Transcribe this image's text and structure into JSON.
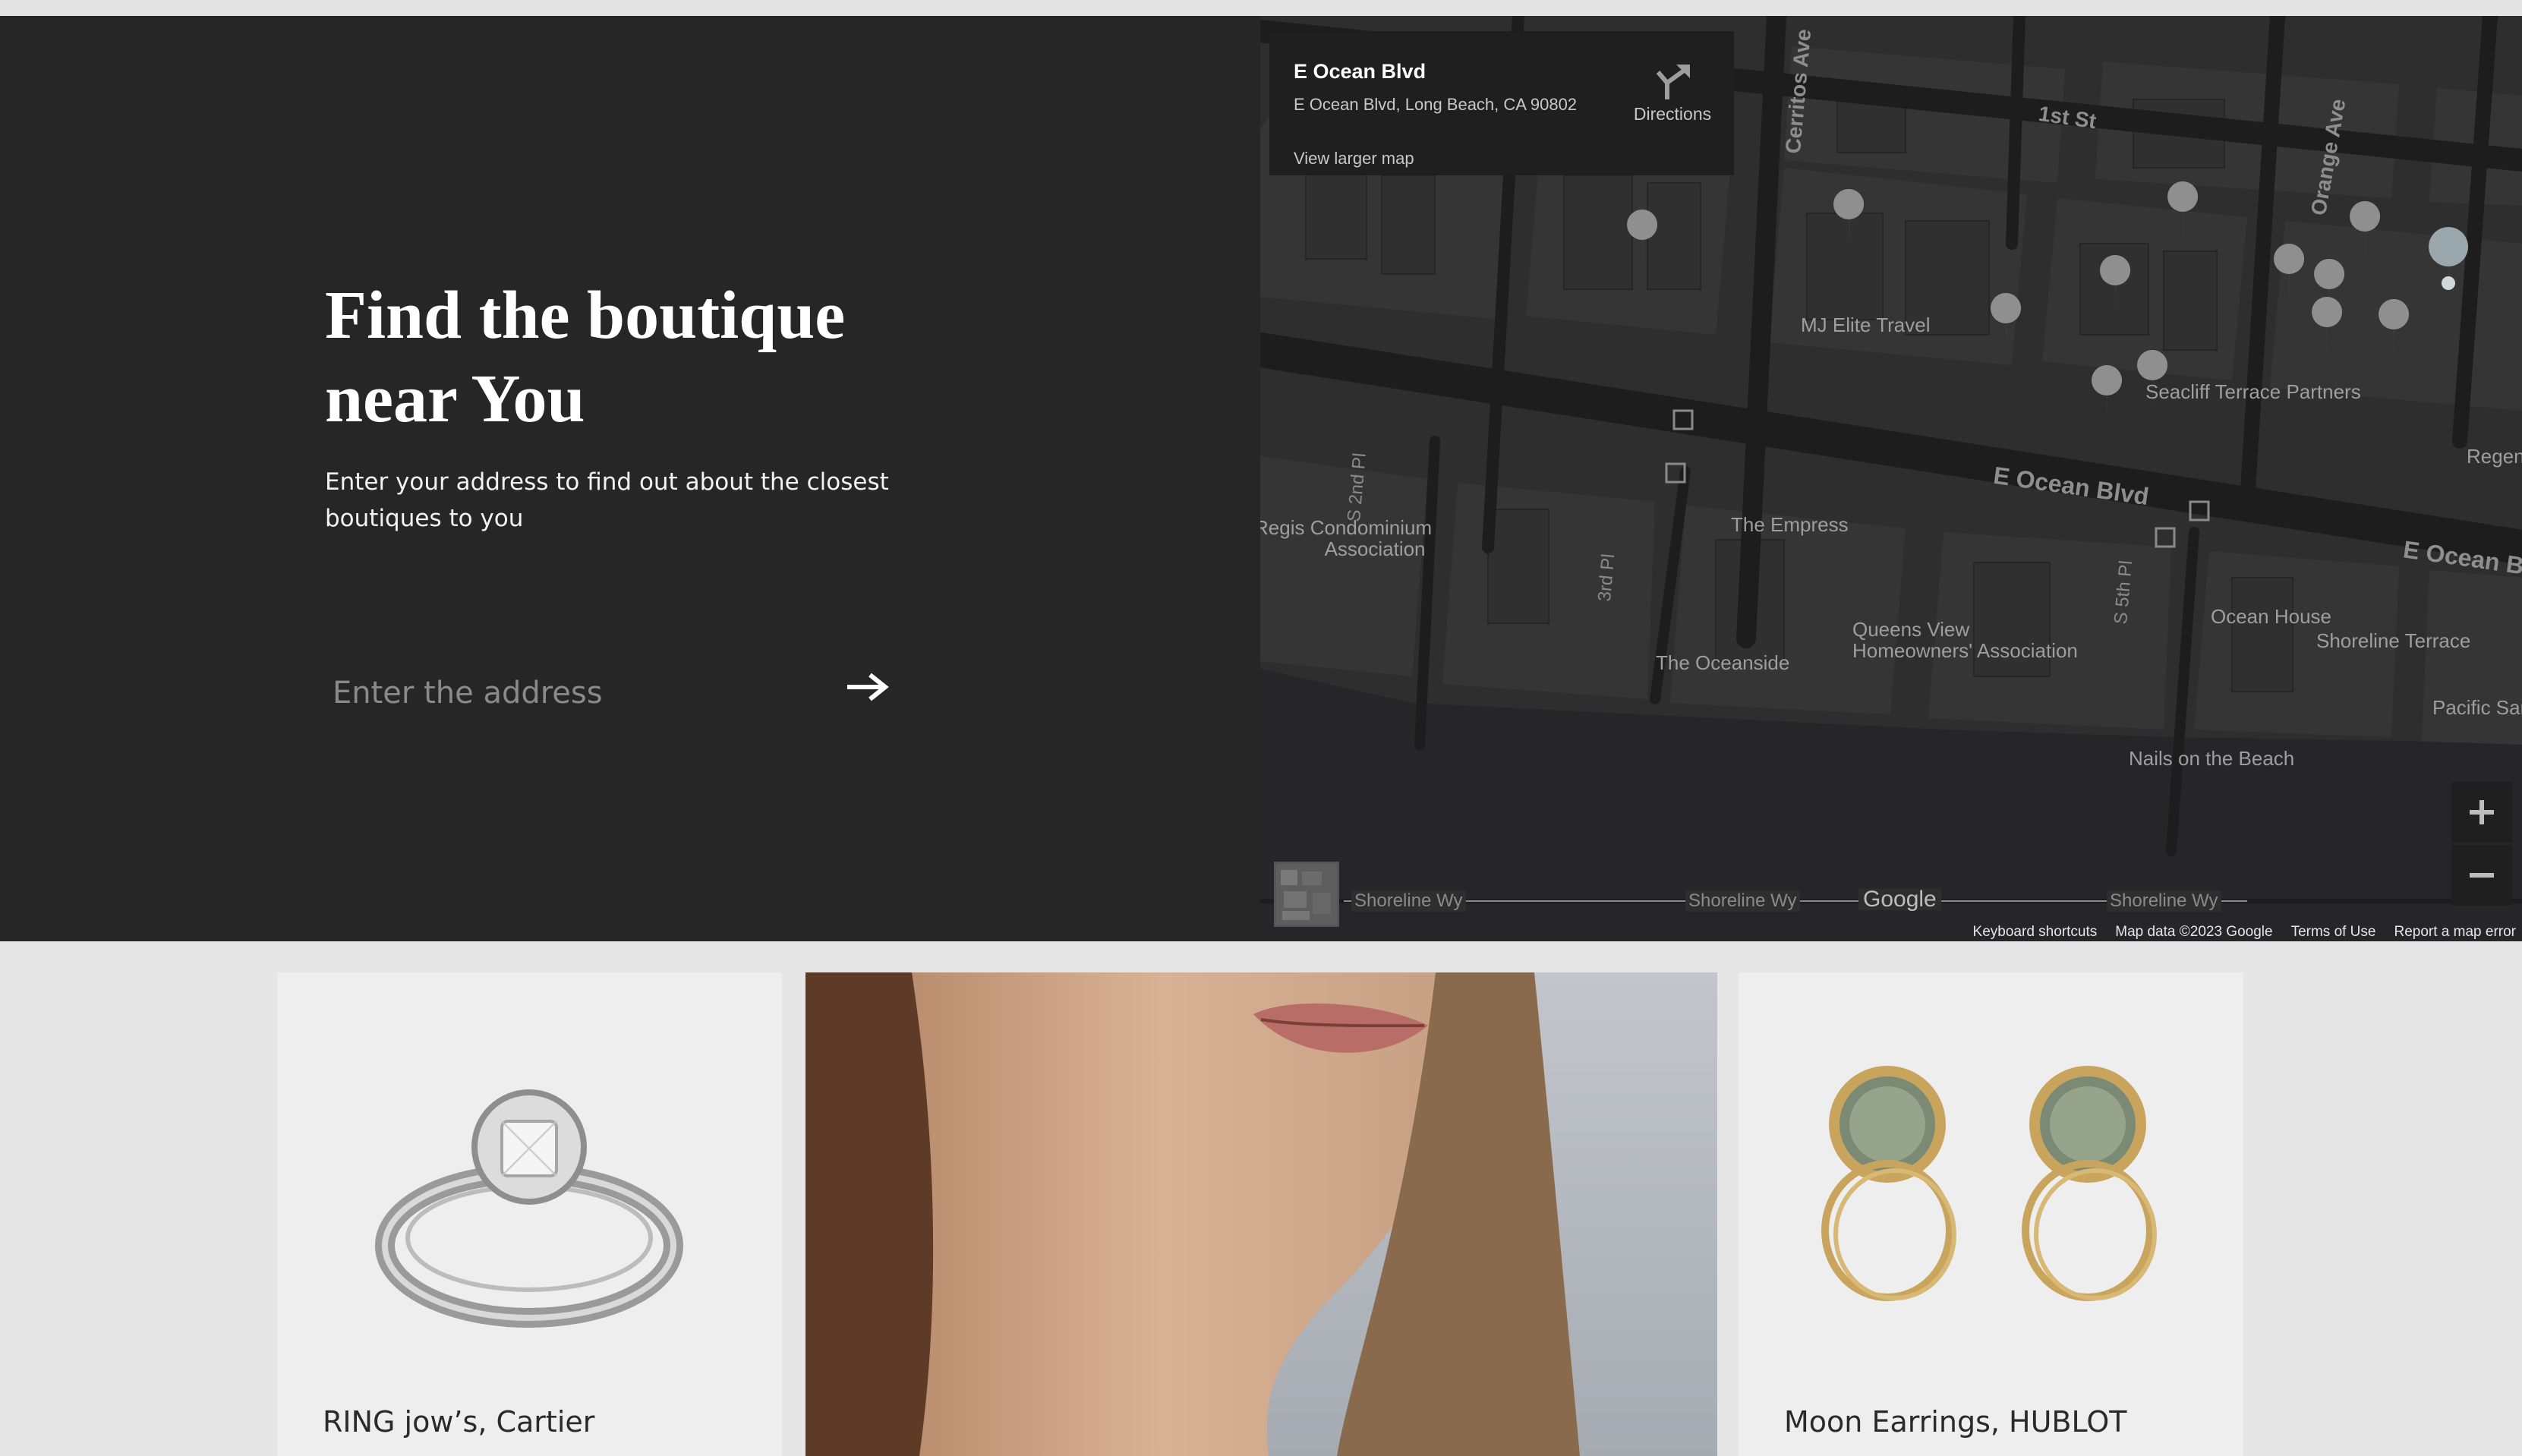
{
  "finder": {
    "title_line1": "Find the boutique",
    "title_line2": "near You",
    "description_line1": "Enter your address to find out about the closest",
    "description_line2": "boutiques to you",
    "address_placeholder": "Enter the address",
    "submit_icon": "arrow-right-icon"
  },
  "map": {
    "place_card": {
      "name": "E Ocean Blvd",
      "address": "E Ocean Blvd, Long Beach, CA 90802",
      "directions_label": "Directions",
      "view_larger": "View larger map"
    },
    "streets": {
      "cerritos": "Cerritos Ave",
      "first_st": "1st St",
      "orange": "Orange Ave",
      "ocean_blvd": "E Ocean Blvd",
      "ocean_blvd_east": "E Ocean Bl",
      "s_2nd_pl": "S 2nd Pl",
      "third_pl": "3rd Pl",
      "s_5th_pl": "S 5th Pl",
      "shoreline_1": "Shoreline Wy",
      "shoreline_2": "Shoreline Wy",
      "shoreline_3": "Shoreline Wy"
    },
    "places": {
      "mj_elite": "MJ Elite Travel",
      "seacliff": "Seacliff Terrace Partners",
      "regent": "Regent",
      "regis_line1": "Regis Condominium",
      "regis_line2": "Association",
      "empress": "The Empress",
      "queens_line1": "Queens View",
      "queens_line2": "Homeowners' Association",
      "oceanside": "The Oceanside",
      "ocean_house": "Ocean House",
      "shoreline_terrace": "Shoreline Terrace",
      "pacific": "Pacific Sand",
      "nails": "Nails on the Beach"
    },
    "google_logo": "Google",
    "zoom_in_icon": "plus-icon",
    "zoom_out_icon": "minus-icon",
    "attribution": {
      "shortcuts": "Keyboard shortcuts",
      "data": "Map data ©2023 Google",
      "terms": "Terms of Use",
      "report": "Report a map error"
    }
  },
  "products": [
    {
      "label": "RING jow’s, Cartier"
    },
    {
      "label": ""
    },
    {
      "label": "Moon Earrings, HUBLOT"
    }
  ],
  "colors": {
    "panel_dark": "#262626",
    "map_bg": "#2b2b2b",
    "card_bg": "#eeeeee",
    "page_bg": "#e6e6e6"
  }
}
